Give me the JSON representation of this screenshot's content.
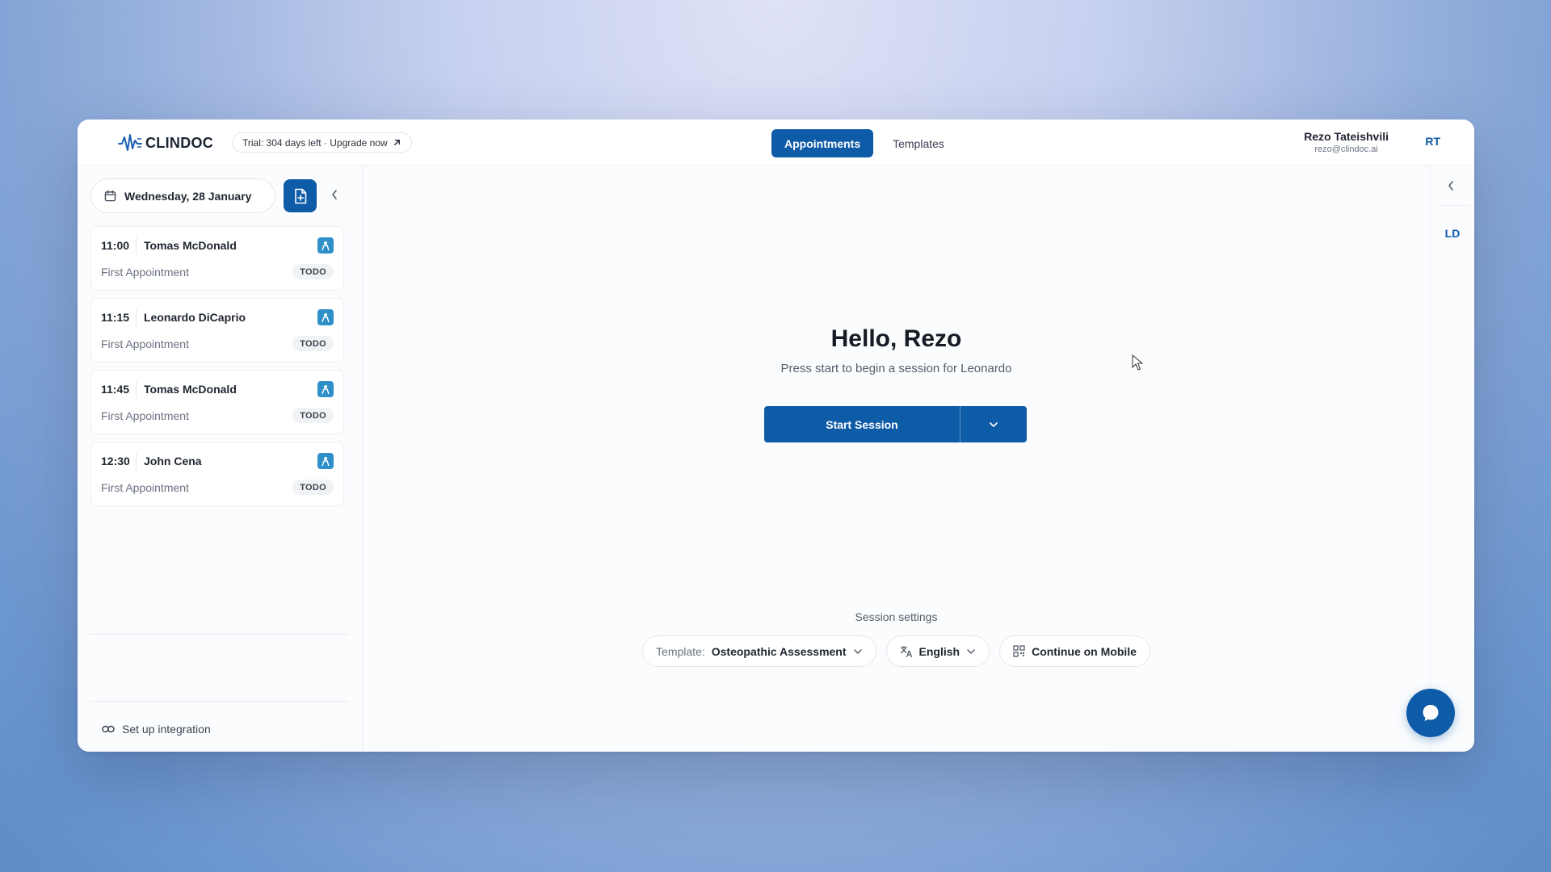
{
  "header": {
    "logo_text": "CLINDOC",
    "trial_text": "Trial: 304 days left · Upgrade now",
    "tabs": [
      {
        "label": "Appointments",
        "active": true
      },
      {
        "label": "Templates",
        "active": false
      }
    ],
    "user_name": "Rezo Tateishvili",
    "user_email": "rezo@clindoc.ai",
    "user_initials": "RT"
  },
  "sidebar": {
    "date": "Wednesday, 28 January",
    "appointments": [
      {
        "time": "11:00",
        "name": "Tomas McDonald",
        "type": "First Appointment",
        "status": "TODO"
      },
      {
        "time": "11:15",
        "name": "Leonardo DiCaprio",
        "type": "First Appointment",
        "status": "TODO"
      },
      {
        "time": "11:45",
        "name": "Tomas McDonald",
        "type": "First Appointment",
        "status": "TODO"
      },
      {
        "time": "12:30",
        "name": "John Cena",
        "type": "First Appointment",
        "status": "TODO"
      }
    ],
    "integration_label": "Set up integration"
  },
  "main": {
    "greeting": "Hello, Rezo",
    "subtitle": "Press start to begin a session for Leonardo",
    "start_label": "Start Session",
    "settings_label": "Session settings",
    "template_prefix": "Template:",
    "template_value": "Osteopathic Assessment",
    "language": "English",
    "continue_mobile": "Continue on Mobile"
  },
  "right_rail": {
    "initials": "LD"
  },
  "colors": {
    "primary": "#0e5ba8",
    "appointment_icon": "#2f8fc9"
  }
}
